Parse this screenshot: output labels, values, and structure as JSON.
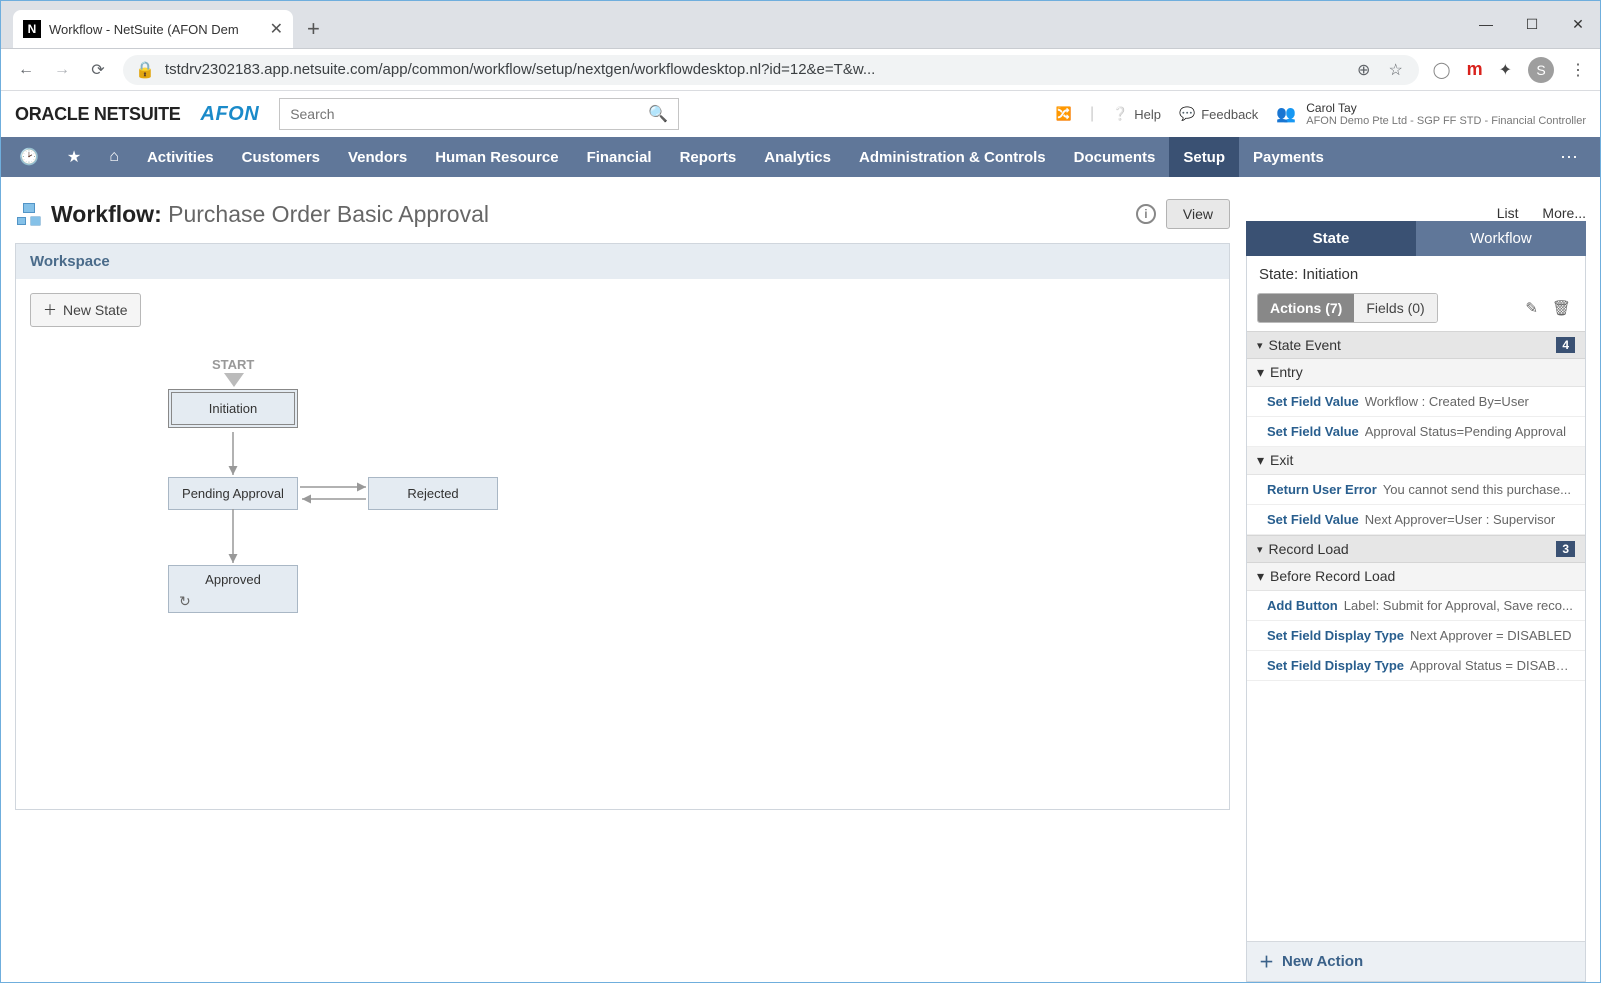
{
  "browser": {
    "tab_title": "Workflow - NetSuite (AFON Dem",
    "favicon": "N",
    "url": "tstdrv2302183.app.netsuite.com/app/common/workflow/setup/nextgen/workflowdesktop.nl?id=12&e=T&w...",
    "avatar": "S"
  },
  "ns_header": {
    "logo": "ORACLE NETSUITE",
    "partner": "AFON",
    "search_placeholder": "Search",
    "help": "Help",
    "feedback": "Feedback",
    "user_name": "Carol Tay",
    "user_sub": "AFON Demo Pte Ltd - SGP FF STD - Financial Controller"
  },
  "nav": {
    "items": [
      "Activities",
      "Customers",
      "Vendors",
      "Human Resource",
      "Financial",
      "Reports",
      "Analytics",
      "Administration & Controls",
      "Documents",
      "Setup",
      "Payments"
    ],
    "active": "Setup"
  },
  "page": {
    "title_prefix": "Workflow:",
    "title_name": "Purchase Order Basic Approval",
    "view_btn": "View",
    "list": "List",
    "more": "More..."
  },
  "workspace": {
    "title": "Workspace",
    "new_state": "New State",
    "start": "START",
    "nodes": {
      "init": "Initiation",
      "pending": "Pending Approval",
      "rejected": "Rejected",
      "approved": "Approved"
    }
  },
  "panel": {
    "tab_state": "State",
    "tab_workflow": "Workflow",
    "state_label": "State: Initiation",
    "sub_actions": "Actions (7)",
    "sub_fields": "Fields (0)",
    "sections": {
      "state_event": {
        "title": "State Event",
        "badge": "4"
      },
      "entry": "Entry",
      "exit": "Exit",
      "record_load": {
        "title": "Record Load",
        "badge": "3"
      },
      "before_load": "Before Record Load"
    },
    "actions": {
      "entry1": {
        "act": "Set Field Value",
        "desc": "Workflow : Created By=User"
      },
      "entry2": {
        "act": "Set Field Value",
        "desc": "Approval Status=Pending Approval"
      },
      "exit1": {
        "act": "Return User Error",
        "desc": "You cannot send this purchase..."
      },
      "exit2": {
        "act": "Set Field Value",
        "desc": "Next Approver=User : Supervisor"
      },
      "load1": {
        "act": "Add Button",
        "desc": "Label: Submit for Approval, Save reco..."
      },
      "load2": {
        "act": "Set Field Display Type",
        "desc": "Next Approver = DISABLED"
      },
      "load3": {
        "act": "Set Field Display Type",
        "desc": "Approval Status = DISABLED"
      }
    },
    "new_action": "New Action"
  }
}
